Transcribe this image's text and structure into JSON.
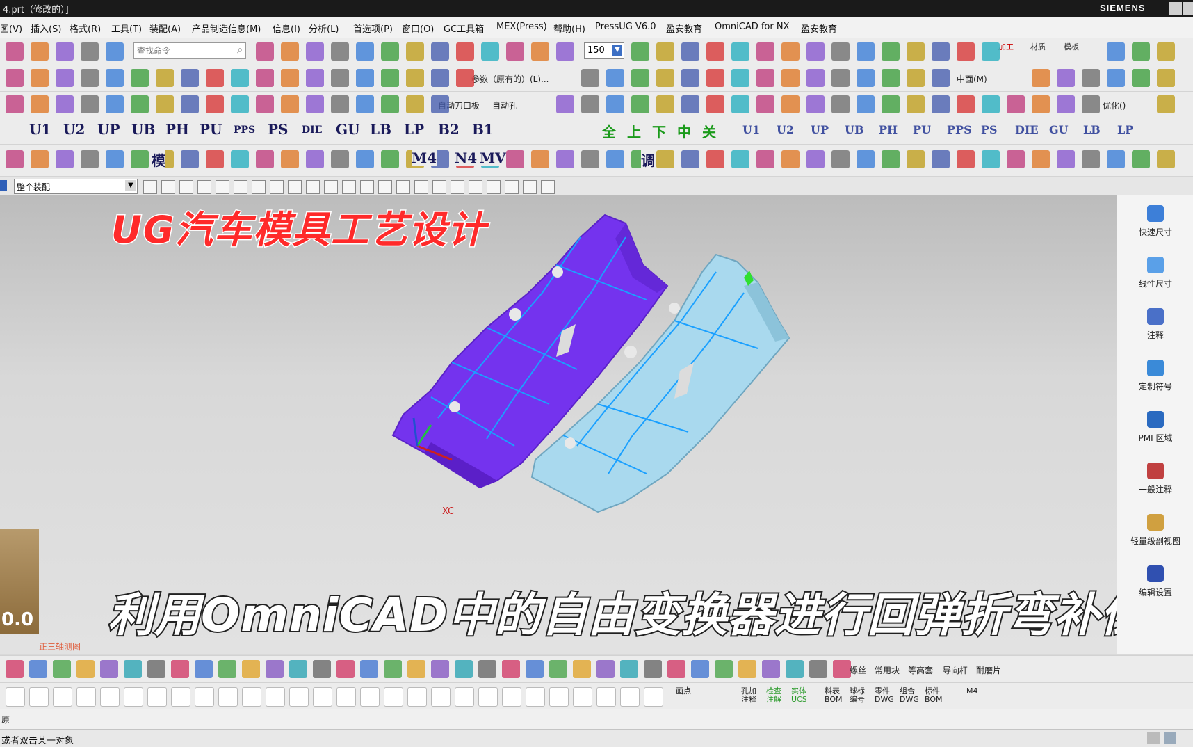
{
  "window": {
    "title": "4.prt（修改的）]",
    "brand": "SIEMENS"
  },
  "menu": [
    "图(V)",
    "插入(S)",
    "格式(R)",
    "工具(T)",
    "装配(A)",
    "产品制造信息(M)",
    "信息(I)",
    "分析(L)",
    "首选项(P)",
    "窗口(O)",
    "GC工具箱",
    "MEX(Press)",
    "帮助(H)",
    "PressUG V6.0",
    "盈安教育",
    "OmniCAD for NX",
    "盈安教育"
  ],
  "toolbar": {
    "search_placeholder": "查找命令",
    "zoom_value": "150",
    "row4_labels": [
      "U1",
      "U2",
      "UP",
      "UB",
      "PH",
      "PU",
      "PPS",
      "PS",
      "DIE",
      "GU",
      "LB",
      "LP",
      "B2",
      "B1"
    ],
    "row4_labels_right": [
      "U1",
      "U2",
      "UP",
      "UB",
      "PH",
      "PU",
      "PPS",
      "PS",
      "DIE",
      "GU",
      "LB",
      "LP"
    ],
    "row3_texts": [
      "自动刀口板",
      "自动孔",
      "优化()"
    ],
    "row2_texts": [
      "参数（原有的）(L)...",
      "中面(M)"
    ],
    "row4_chars": [
      "全",
      "上",
      "下",
      "中",
      "关"
    ],
    "row5_texts": [
      "模",
      "M4",
      "N4",
      "MV",
      "调"
    ],
    "mode_label": "加工",
    "material_label": "材质",
    "template_label": "模板"
  },
  "selection_bar": {
    "filter": "整个装配"
  },
  "viewport": {
    "overlay_title": "UG汽车模具工艺设计",
    "overlay_caption": "利用OmniCAD中的自由变换器进行回弹折弯补偿",
    "axis_label": "XC",
    "view_name": "正三轴测图",
    "corner_text": "0.0"
  },
  "resource_bar": [
    {
      "label": "快速尺寸",
      "icon": "quick-dimension-icon"
    },
    {
      "label": "线性尺寸",
      "icon": "linear-dimension-icon"
    },
    {
      "label": "注释",
      "icon": "note-icon"
    },
    {
      "label": "定制符号",
      "icon": "custom-symbol-icon"
    },
    {
      "label": "PMI 区域",
      "icon": "pmi-region-icon"
    },
    {
      "label": "一般注释",
      "icon": "general-note-icon"
    },
    {
      "label": "轻量级剖视图",
      "icon": "section-view-icon"
    },
    {
      "label": "编辑设置",
      "icon": "edit-settings-icon"
    }
  ],
  "bottom_toolbar": {
    "texts": [
      "螺丝",
      "常用块",
      "等高套",
      "导向杆",
      "耐磨片"
    ],
    "row2_texts": [
      "孔加注释",
      "检查注解",
      "实体UCS",
      "料表BOM",
      "球标编号",
      "零件DWG",
      "组合DWG",
      "标件BOM",
      "M4",
      "画点"
    ]
  },
  "status": {
    "origin": "原",
    "message": "或者双击某一对象"
  },
  "colors": {
    "part_left": "#7a3cf0",
    "part_right": "#a8d8ec",
    "edge_lines": "#1aa0ff",
    "overlay_title": "#ff2a2a"
  }
}
